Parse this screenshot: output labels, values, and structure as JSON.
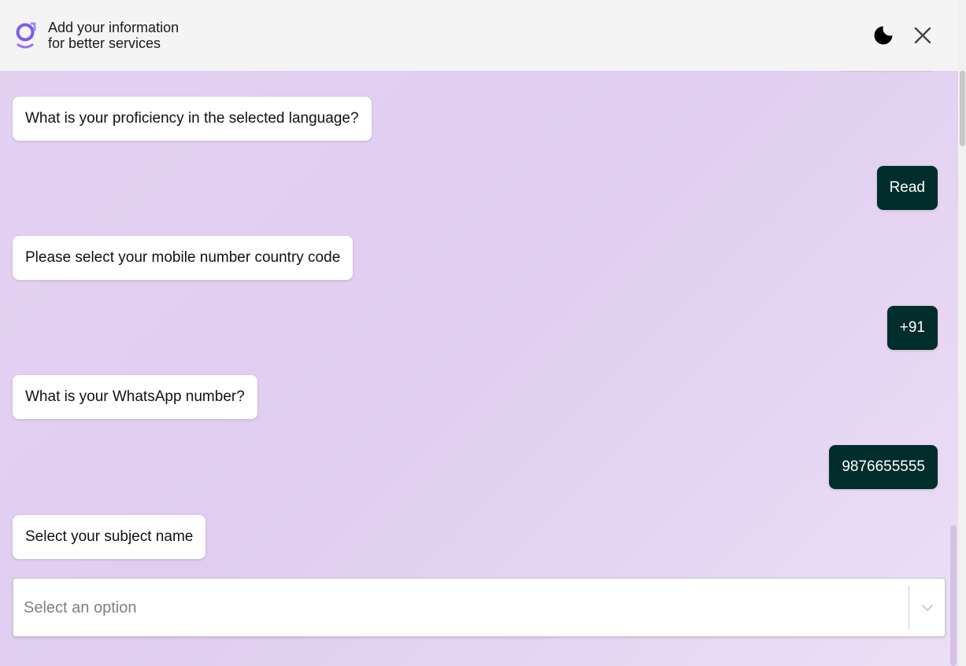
{
  "header": {
    "title_line1": "Add your information",
    "title_line2": "for better services",
    "logo_icon": "brand-logo-icon",
    "theme_icon": "moon-icon",
    "close_icon": "close-icon"
  },
  "messages": [
    {
      "from": "bot",
      "text": "What is your proficiency in the selected language?"
    },
    {
      "from": "user",
      "text": "Read"
    },
    {
      "from": "bot",
      "text": "Please select your mobile number country code"
    },
    {
      "from": "user",
      "text": "+91"
    },
    {
      "from": "bot",
      "text": "What is your WhatsApp number?"
    },
    {
      "from": "user",
      "text": "9876655555"
    },
    {
      "from": "bot",
      "text": "Select your subject name"
    }
  ],
  "subject_select": {
    "placeholder": "Select an option",
    "icon": "chevron-down-icon"
  },
  "colors": {
    "user_bubble": "#012d2d",
    "bot_bubble": "#ffffff",
    "header_bg": "#f4f4f4",
    "chat_bg": "#e3d2f1",
    "logo_accent": "#8a5cf6"
  }
}
